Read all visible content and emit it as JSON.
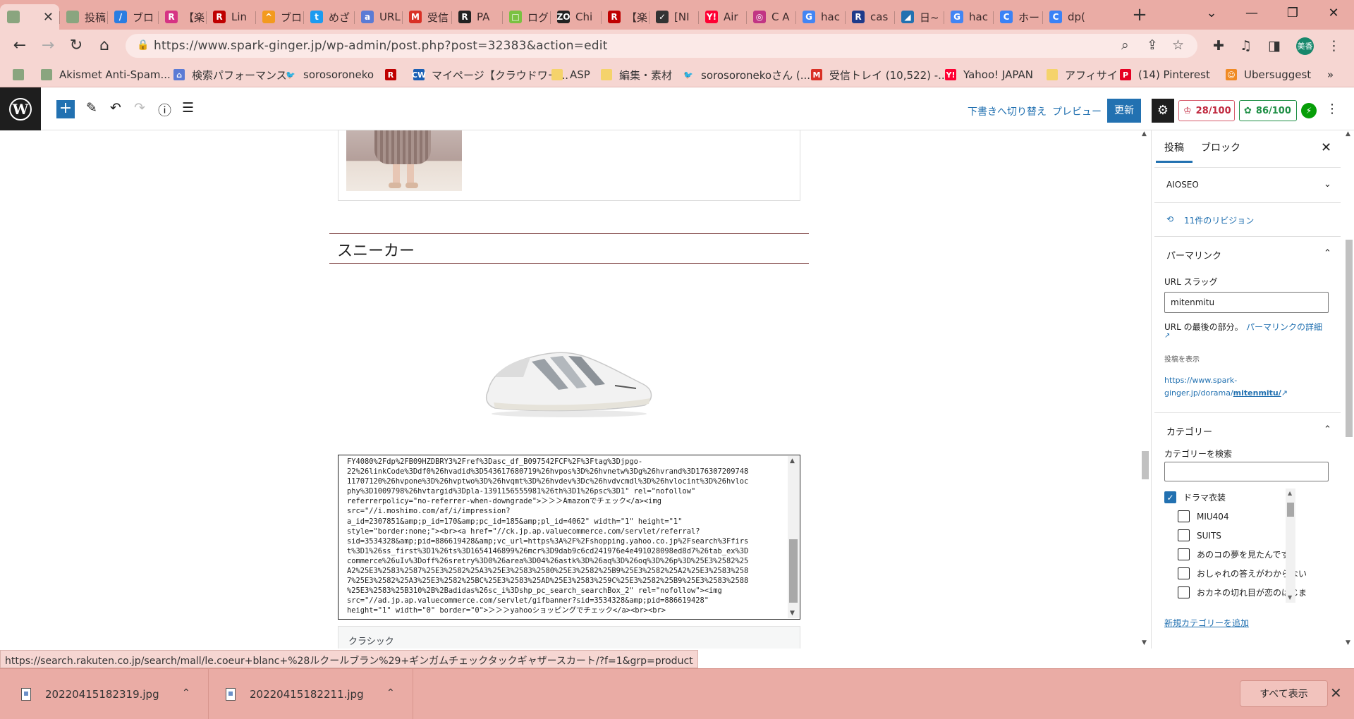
{
  "browser": {
    "tabs": [
      {
        "label": "",
        "fav": "",
        "color": "#8aa57f",
        "active": true
      },
      {
        "label": "投稿",
        "fav": "",
        "color": "#8aa57f"
      },
      {
        "label": "ブロ",
        "fav": "/",
        "color": "#2a7de1"
      },
      {
        "label": "【楽",
        "fav": "R",
        "color": "#d63384"
      },
      {
        "label": "Lin",
        "fav": "R",
        "color": "#bf0000"
      },
      {
        "label": "ブロ",
        "fav": "^",
        "color": "#f39a1e"
      },
      {
        "label": "めざ",
        "fav": "t",
        "color": "#1d9bf0"
      },
      {
        "label": "URL",
        "fav": "a",
        "color": "#5b7bd5"
      },
      {
        "label": "受信",
        "fav": "M",
        "color": "#d93025"
      },
      {
        "label": "PA",
        "fav": "R",
        "color": "#222222"
      },
      {
        "label": "ログ",
        "fav": "□",
        "color": "#7ac142"
      },
      {
        "label": "Chi",
        "fav": "ZO",
        "color": "#222222"
      },
      {
        "label": "【楽",
        "fav": "R",
        "color": "#bf0000"
      },
      {
        "label": "[NI",
        "fav": "✓",
        "color": "#333333"
      },
      {
        "label": "Air",
        "fav": "Y!",
        "color": "#ff0033"
      },
      {
        "label": "C A",
        "fav": "◎",
        "color": "#c13584"
      },
      {
        "label": "hac",
        "fav": "G",
        "color": "#4285f4"
      },
      {
        "label": "cas",
        "fav": "R",
        "color": "#1e3a8a"
      },
      {
        "label": "日~",
        "fav": "◢",
        "color": "#2271b1"
      },
      {
        "label": "hac",
        "fav": "G",
        "color": "#4285f4"
      },
      {
        "label": "ホー",
        "fav": "C",
        "color": "#3b82f6"
      },
      {
        "label": "dp(",
        "fav": "C",
        "color": "#3b82f6"
      }
    ],
    "url": "https://www.spark-ginger.jp/wp-admin/post.php?post=32383&action=edit",
    "profile_label": "美香",
    "bookmarks": [
      {
        "label": "",
        "fav": "",
        "color": "#8aa57f"
      },
      {
        "label": "Akismet Anti-Spam...",
        "fav": "",
        "color": "#8aa57f"
      },
      {
        "label": "検索パフォーマンス",
        "fav": "⌂",
        "color": "#5b7bd5"
      },
      {
        "label": "sorosoroneko",
        "fav": "t",
        "color": "#1d9bf0"
      },
      {
        "label": "",
        "fav": "R",
        "color": "#bf0000"
      },
      {
        "label": "マイページ【クラウドワー...",
        "fav": "CW",
        "color": "#1a5fb4"
      },
      {
        "label": "ASP",
        "fav": "",
        "color": "#f5d36b"
      },
      {
        "label": "編集・素材",
        "fav": "",
        "color": "#f5d36b"
      },
      {
        "label": "sorosoronekoさん (...",
        "fav": "t",
        "color": "#1d9bf0"
      },
      {
        "label": "受信トレイ (10,522) -...",
        "fav": "M",
        "color": "#d93025"
      },
      {
        "label": "Yahoo! JAPAN",
        "fav": "Y!",
        "color": "#ff0033"
      },
      {
        "label": "アフィサイト",
        "fav": "",
        "color": "#f5d36b"
      },
      {
        "label": "(14) Pinterest",
        "fav": "P",
        "color": "#e60023"
      },
      {
        "label": "Ubersuggest",
        "fav": "☺",
        "color": "#f08a24"
      }
    ],
    "more_bookmarks": "»"
  },
  "wp_toolbar": {
    "switch_draft": "下書きへ切り替え",
    "preview": "プレビュー",
    "update": "更新",
    "score1": "28/100",
    "score2": "86/100"
  },
  "editor": {
    "heading": "スニーカー",
    "code_lines": [
      "FY4080%2Fdp%2FB09HZDBRY3%2Fref%3Dasc_df_B097542FCF%2F%3Ftag%3Djpgo-",
      "22%26linkCode%3Ddf0%26hvadid%3D543617680719%26hvpos%3D%26hvnetw%3Dg%26hvrand%3D176307209748",
      "11707120%26hvpone%3D%26hvptwo%3D%26hvqmt%3D%26hvdev%3Dc%26hvdvcmdl%3D%26hvlocint%3D%26hvloc",
      "phy%3D1009798%26hvtargid%3Dpla-1391156555981%26th%3D1%26psc%3D1\" rel=\"nofollow\"",
      "referrerpolicy=\"no-referrer-when-downgrade\">＞＞＞Amazonでチェック</a><img",
      "src=\"//i.moshimo.com/af/i/impression?",
      "a_id=2307851&amp;p_id=170&amp;pc_id=185&amp;pl_id=4062\" width=\"1\" height=\"1\"",
      "style=\"border:none;\"><br><a href=\"//ck.jp.ap.valuecommerce.com/servlet/referral?",
      "sid=3534328&amp;pid=886619428&amp;vc_url=https%3A%2F%2Fshopping.yahoo.co.jp%2Fsearch%3Ffirs",
      "t%3D1%26ss_first%3D1%26ts%3D1654146899%26mcr%3D9dab9c6cd241976e4e491028098ed8d7%26tab_ex%3D",
      "commerce%26uIv%3Doff%26sretry%3D0%26area%3D04%26astk%3D%26aq%3D%26oq%3D%26p%3D%25E3%2582%25",
      "A2%25E3%2583%2587%25E3%2582%25A3%25E3%2583%2580%25E3%2582%25B9%25E3%2582%25A2%25E3%2583%258",
      "7%25E3%2582%25A3%25E3%2582%25BC%25E3%2583%25AD%25E3%2583%259C%25E3%2582%25B9%25E3%2583%2588",
      "%25E3%2583%25B310%2B%2Badidas%26sc_i%3Dshp_pc_search_searchBox_2\" rel=\"nofollow\"><img",
      "src=\"//ad.jp.ap.valuecommerce.com/servlet/gifbanner?sid=3534328&amp;pid=886619428\"",
      "height=\"1\" width=\"0\" border=\"0\">＞＞＞yahooショッピングでチェック</a><br><br>"
    ],
    "classic_label": "クラシック"
  },
  "sidebar": {
    "tab_post": "投稿",
    "tab_block": "ブロック",
    "aioseo": "AIOSEO",
    "revisions": "11件のリビジョン",
    "permalink_title": "パーマリンク",
    "slug_label": "URL スラッグ",
    "slug_value": "mitenmitu",
    "slug_help": "URL の最後の部分。",
    "slug_help_link": "パーマリンクの詳細",
    "view_post_label": "投稿を表示",
    "view_post_link1": "https://www.spark-",
    "view_post_link2a": "ginger.jp/dorama/",
    "view_post_link2b": "mitenmitu/",
    "category_title": "カテゴリー",
    "category_search_label": "カテゴリーを検索",
    "categories": [
      {
        "label": "ドラマ衣装",
        "checked": true
      },
      {
        "label": "MIU404",
        "checked": false
      },
      {
        "label": "SUITS",
        "checked": false
      },
      {
        "label": "あのコの夢を見たんです",
        "checked": false
      },
      {
        "label": "おしゃれの答えがわからない",
        "checked": false
      },
      {
        "label": "おカネの切れ目が恋のはじま",
        "checked": false
      }
    ],
    "add_category": "新規カテゴリーを追加"
  },
  "status_url": "https://search.rakuten.co.jp/search/mall/le.coeur+blanc+%28ルクールブラン%29+ギンガムチェックタックギャザースカート/?f=1&grp=product",
  "downloads": {
    "items": [
      "20220415182319.jpg",
      "20220415182211.jpg"
    ],
    "show_all": "すべて表示"
  }
}
